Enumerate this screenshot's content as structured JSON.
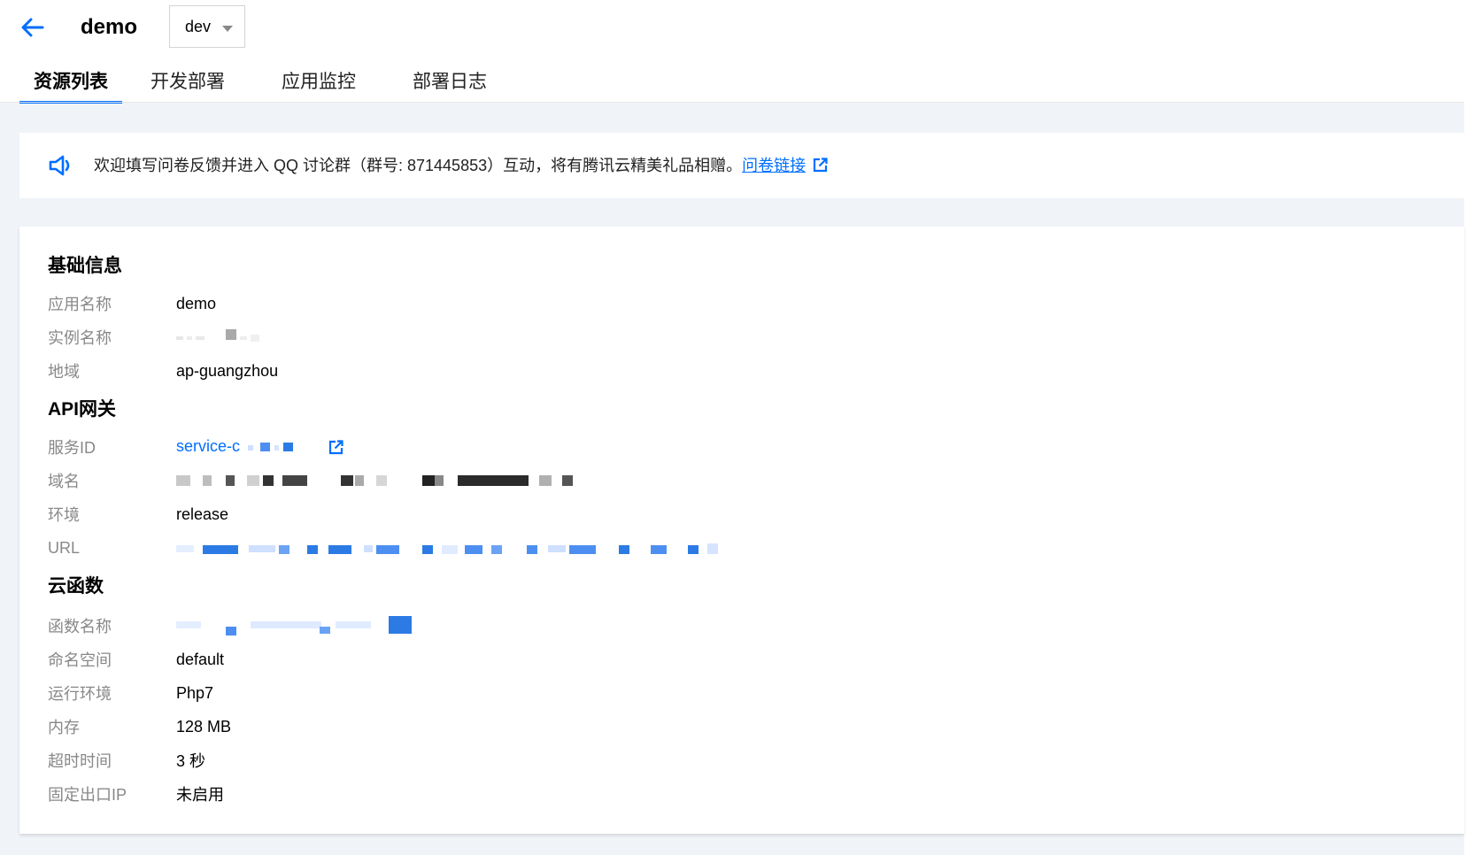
{
  "header": {
    "title": "demo",
    "env_selected": "dev"
  },
  "tabs": [
    {
      "label": "资源列表",
      "active": true
    },
    {
      "label": "开发部署",
      "active": false
    },
    {
      "label": "应用监控",
      "active": false
    },
    {
      "label": "部署日志",
      "active": false
    }
  ],
  "notice": {
    "text": "欢迎填写问卷反馈并进入 QQ 讨论群（群号: 871445853）互动，将有腾讯云精美礼品相赠。",
    "link_text": "问卷链接"
  },
  "basic_info": {
    "title": "基础信息",
    "rows": [
      {
        "label": "应用名称",
        "value": "demo"
      },
      {
        "label": "实例名称",
        "value": ""
      },
      {
        "label": "地域",
        "value": "ap-guangzhou"
      }
    ]
  },
  "api_gateway": {
    "title": "API网关",
    "rows": [
      {
        "label": "服务ID",
        "value": "service-c"
      },
      {
        "label": "域名",
        "value": ""
      },
      {
        "label": "环境",
        "value": "release"
      },
      {
        "label": "URL",
        "value": ""
      }
    ]
  },
  "cloud_function": {
    "title": "云函数",
    "rows": [
      {
        "label": "函数名称",
        "value": ""
      },
      {
        "label": "命名空间",
        "value": "default"
      },
      {
        "label": "运行环境",
        "value": "Php7"
      },
      {
        "label": "内存",
        "value": "128 MB"
      },
      {
        "label": "超时时间",
        "value": "3 秒"
      },
      {
        "label": "固定出口IP",
        "value": "未启用"
      }
    ]
  },
  "colors": {
    "accent": "#006eff",
    "label": "#888888",
    "background": "#f0f3f7"
  }
}
